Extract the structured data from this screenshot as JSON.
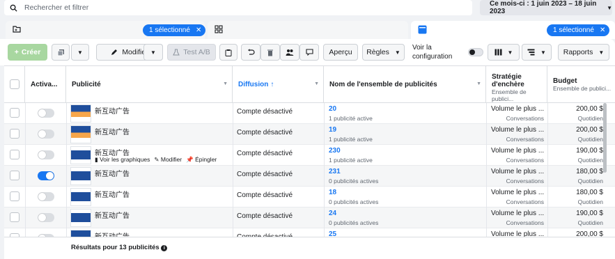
{
  "search": {
    "placeholder": "Rechercher et filtrer"
  },
  "date_range": {
    "label": "Ce mois-ci : 1 juin 2023 – 18 juin 2023"
  },
  "level_tabs": [
    {
      "icon": "folder-icon",
      "pill": ""
    },
    {
      "icon": "grid-icon",
      "pill": "1 sélectionné"
    },
    {
      "icon": "ad-icon",
      "pill": "1 sélectionné"
    }
  ],
  "toolbar": {
    "create": "Créer",
    "edit": "Modifier",
    "ab_test": "Test A/B",
    "preview": "Aperçu",
    "rules": "Règles",
    "view_config": "Voir la configuration",
    "reports": "Rapports"
  },
  "columns": {
    "status": "Activa...",
    "ad": "Publicité",
    "delivery": "Diffusion",
    "adset": "Nom de l'ensemble de publicités",
    "bid": "Stratégie d'enchère",
    "bid_sub": "Ensemble de publici...",
    "budget": "Budget",
    "budget_sub": "Ensemble de publici..."
  },
  "rows": [
    {
      "name": "新互动广告",
      "delivery": "Compte désactivé",
      "adset": "20",
      "adset_sub": "1 publicité active",
      "bid": "Volume le plus ...",
      "bid_sub": "Conversations",
      "budget": "200,00 $",
      "budget_sub": "Quotidien",
      "on": false,
      "thumb": "offer"
    },
    {
      "name": "新互动广告",
      "delivery": "Compte désactivé",
      "adset": "19",
      "adset_sub": "1 publicité active",
      "bid": "Volume le plus ...",
      "bid_sub": "Conversations",
      "budget": "200,00 $",
      "budget_sub": "Quotidien",
      "on": false,
      "thumb": "offer"
    },
    {
      "name": "新互动广告",
      "delivery": "Compte désactivé",
      "adset": "230",
      "adset_sub": "1 publicité active",
      "bid": "Volume le plus ...",
      "bid_sub": "Conversations",
      "budget": "190,00 $",
      "budget_sub": "Quotidien",
      "on": false,
      "thumb": "hire",
      "row_actions": [
        "Voir les graphiques",
        "Modifier",
        "Épingler"
      ]
    },
    {
      "name": "新互动广告",
      "delivery": "Compte désactivé",
      "adset": "231",
      "adset_sub": "0 publicités actives",
      "bid": "Volume le plus ...",
      "bid_sub": "Conversations",
      "budget": "180,00 $",
      "budget_sub": "Quotidien",
      "on": true,
      "thumb": "hire"
    },
    {
      "name": "新互动广告",
      "delivery": "Compte désactivé",
      "adset": "18",
      "adset_sub": "0 publicités actives",
      "bid": "Volume le plus ...",
      "bid_sub": "Conversations",
      "budget": "180,00 $",
      "budget_sub": "Quotidien",
      "on": false,
      "thumb": "hire"
    },
    {
      "name": "新互动广告",
      "delivery": "Compte désactivé",
      "adset": "24",
      "adset_sub": "0 publicités actives",
      "bid": "Volume le plus ...",
      "bid_sub": "Conversations",
      "budget": "190,00 $",
      "budget_sub": "Quotidien",
      "on": false,
      "thumb": "hire"
    },
    {
      "name": "新互动广告",
      "delivery": "Compte désactivé",
      "adset": "25",
      "adset_sub": "",
      "bid": "Volume le plus ...",
      "bid_sub": "",
      "budget": "200,00 $",
      "budget_sub": "",
      "on": false,
      "thumb": "offer"
    }
  ],
  "footer": {
    "results": "Résultats pour 13 publicités"
  }
}
